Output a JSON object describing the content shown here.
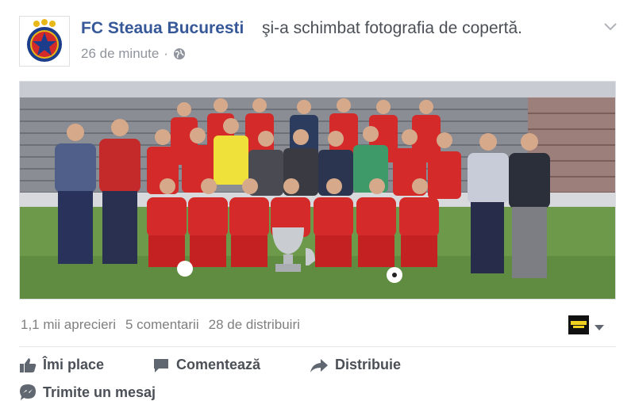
{
  "post": {
    "page_name": "FC Steaua Bucuresti",
    "action_text": "şi-a schimbat fotografia de copertă.",
    "time": "26 de minute",
    "separator": "·",
    "privacy_icon": "globe-icon",
    "menu_icon": "chevron-down-icon"
  },
  "stats": {
    "likes": "1,1 mii aprecieri",
    "comments": "5 comentarii",
    "shares": "28 de distribuiri"
  },
  "actions": {
    "like": "Îmi place",
    "comment": "Comentează",
    "share": "Distribuie",
    "message": "Trimite un mesaj"
  },
  "colors": {
    "link_blue": "#365899",
    "text_gray": "#90949c",
    "action_gray": "#4b4f56",
    "kit_red": "#d42a2a"
  }
}
